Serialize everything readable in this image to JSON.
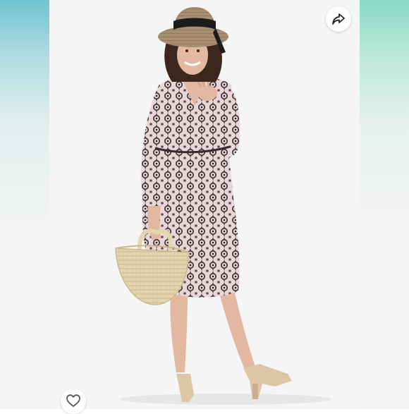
{
  "listing": {
    "photo": {
      "subject": "listing-photo",
      "colors": {
        "background": "#f5f5f5",
        "dress_base": "#e8d7d9",
        "dress_print": "#3a2a30",
        "hat_straw": "#a98f72",
        "hat_band": "#1c1c1c",
        "bag_straw": "#e2d5b0",
        "sandals": "#ddc6a6",
        "skin": "#e2b9a0",
        "hair": "#3c271d"
      }
    },
    "actions": {
      "share_icon": "share-arrow-icon",
      "like_icon": "heart-outline-icon"
    }
  }
}
